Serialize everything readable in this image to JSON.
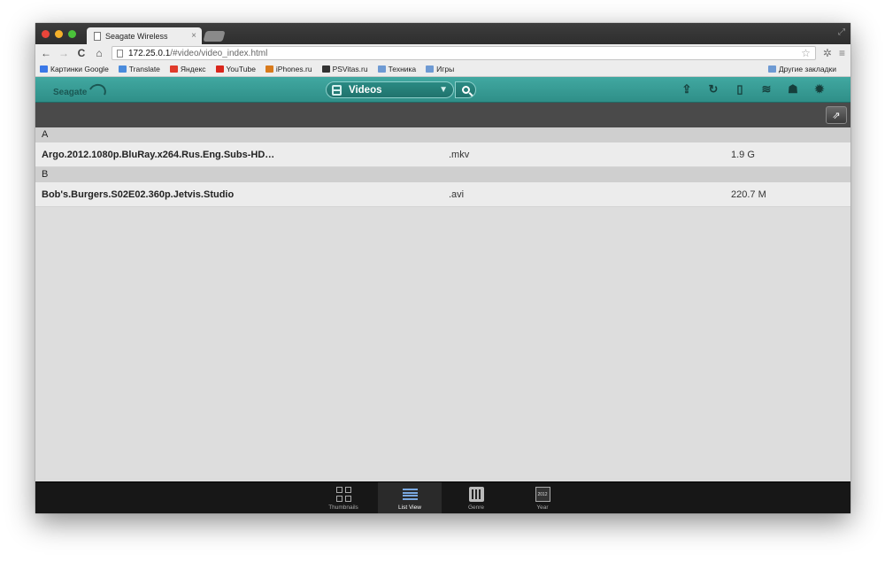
{
  "browser": {
    "tab_title": "Seagate Wireless",
    "tab_close": "×",
    "url_host": "172.25.0.1",
    "url_path": "/#video/video_index.html",
    "bookmarks": [
      {
        "label": "Картинки Google",
        "icon": "google-icon",
        "color": "#3b78e7"
      },
      {
        "label": "Translate",
        "icon": "translate-icon",
        "color": "#4a8bdc"
      },
      {
        "label": "Яндекс",
        "icon": "yandex-icon",
        "color": "#e03b2b"
      },
      {
        "label": "YouTube",
        "icon": "youtube-icon",
        "color": "#d9261c"
      },
      {
        "label": "iPhones.ru",
        "icon": "iphones-icon",
        "color": "#d87a1c"
      },
      {
        "label": "PSVitas.ru",
        "icon": "psvitas-icon",
        "color": "#333333"
      },
      {
        "label": "Техника",
        "icon": "folder-icon",
        "color": "#6e9ad3"
      },
      {
        "label": "Игры",
        "icon": "folder-icon",
        "color": "#6e9ad3"
      }
    ],
    "other_bookmarks": "Другие закладки"
  },
  "app": {
    "logo": "Seagate",
    "accent": "#2f8f88",
    "media_selector": "Videos",
    "header_icons": [
      "upload-icon",
      "sync-icon",
      "device-icon",
      "wifi-icon",
      "users-icon",
      "settings-icon"
    ]
  },
  "list": {
    "groups": [
      {
        "letter": "A",
        "items": [
          {
            "name": "Argo.2012.1080p.BluRay.x264.Rus.Eng.Subs-HD…",
            "ext": ".mkv",
            "size": "1.9 G"
          }
        ]
      },
      {
        "letter": "B",
        "items": [
          {
            "name": "Bob's.Burgers.S02E02.360p.Jetvis.Studio",
            "ext": ".avi",
            "size": "220.7 M"
          }
        ]
      }
    ]
  },
  "bottom_tabs": [
    {
      "label": "Thumbnails",
      "active": false
    },
    {
      "label": "List View",
      "active": true
    },
    {
      "label": "Genre",
      "active": false
    },
    {
      "label": "Year",
      "active": false
    }
  ],
  "year_icon_text": "2012"
}
